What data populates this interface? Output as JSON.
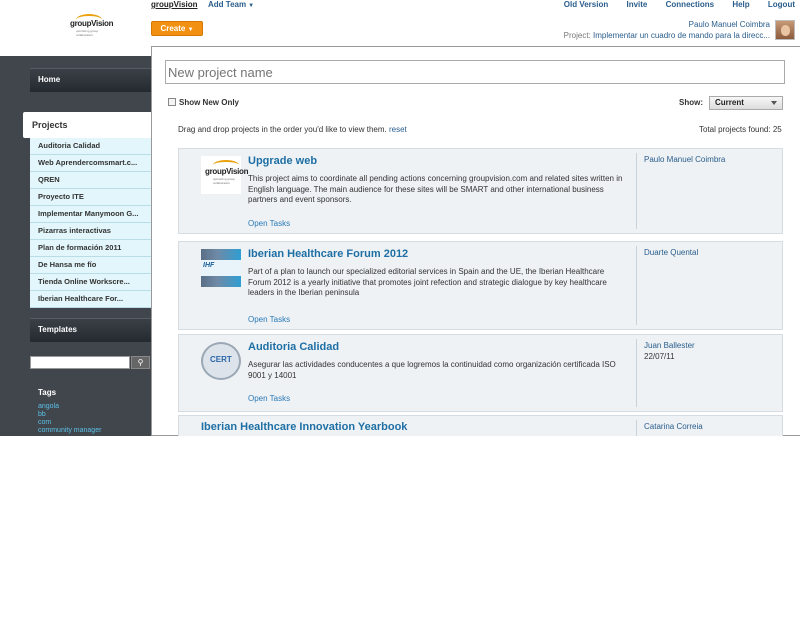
{
  "header": {
    "brand": "groupVision",
    "logo_text": "groupVision",
    "logo_sub": "optimizing group collaboration",
    "add_team": "Add Team",
    "nav": [
      "Old Version",
      "Invite",
      "Connections",
      "Help",
      "Logout"
    ],
    "create_label": "Create",
    "user_name": "Paulo Manuel Coimbra",
    "project_prefix": "Project:",
    "project_name": "Implementar un cuadro de mando para la direcc..."
  },
  "sidebar": {
    "home": "Home",
    "projects": "Projects",
    "project_items": [
      "Auditoria Calidad",
      "Web Aprendercomsmart.c...",
      "QREN",
      "Proyecto ITE",
      "Implementar Manymoon G...",
      "Pizarras interactivas",
      "Plan de formación 2011",
      "De Hansa me fío",
      "Tienda Online Workscre...",
      "Iberian Healthcare For..."
    ],
    "templates": "Templates",
    "search_value": "",
    "tags_title": "Tags",
    "tags": [
      "angola",
      "bb",
      "com",
      "community manager"
    ]
  },
  "main": {
    "new_project_placeholder": "New project name",
    "show_new_only": "Show New Only",
    "show_label": "Show:",
    "show_value": "Current",
    "drag_hint": "Drag and drop projects in the order you'd like to view them.",
    "reset": "reset",
    "total": "Total projects found: 25",
    "projects": [
      {
        "title": "Upgrade web",
        "description": "This project aims to coordinate all pending actions concerning groupvision.com and related sites written in English language. The main audience for these sites will be SMART and other international business partners and event sponsors.",
        "tasks": "Open Tasks",
        "owner": "Paulo Manuel Coimbra",
        "date": "",
        "thumb": "groupVision"
      },
      {
        "title": "Iberian Healthcare Forum 2012",
        "description": "Part of a plan to launch our specialized editorial services in Spain and the UE, the Iberian Healthcare Forum 2012 is a yearly initiative that promotes joint refection and strategic dialogue by key healthcare leaders in the Iberian peninsula",
        "tasks": "Open Tasks",
        "owner": "Duarte Quental",
        "date": "",
        "thumb": "IHF"
      },
      {
        "title": "Auditoria Calidad",
        "description": "Asegurar las actividades conducentes a que logremos la continuidad como organización certificada ISO 9001 y 14001",
        "tasks": "Open Tasks",
        "owner": "Juan Ballester",
        "date": "22/07/11",
        "thumb": "CERT"
      },
      {
        "title": "Iberian Healthcare Innovation Yearbook",
        "description": "",
        "tasks": "",
        "owner": "Catarina Correia",
        "date": ""
      }
    ]
  }
}
